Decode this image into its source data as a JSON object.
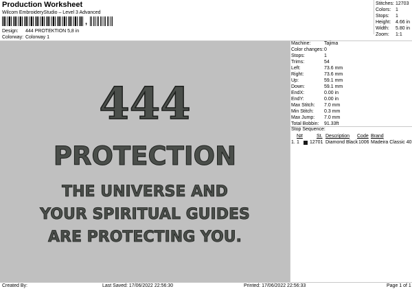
{
  "header": {
    "title": "Production Worksheet",
    "subtitle": "Wilcom EmbroideryStudio – Level 3 Advanced",
    "barcode_mark": ",",
    "design_label": "Design:",
    "design_value": "444 PROTEKTION 5,8 in",
    "colorway_label": "Colorway:",
    "colorway_value": "Colorway 1"
  },
  "stats": [
    {
      "label": "Stitches:",
      "value": "12703"
    },
    {
      "label": "Colors:",
      "value": "1"
    },
    {
      "label": "Stops:",
      "value": "1"
    },
    {
      "label": "Height:",
      "value": "4.66 in"
    },
    {
      "label": "Width:",
      "value": "5.80 in"
    },
    {
      "label": "Zoom:",
      "value": "1:1"
    }
  ],
  "design": {
    "line1": "444",
    "line2": "PROTECTION",
    "line3": "THE UNIVERSE AND",
    "line4": "YOUR SPIRITUAL GUIDES",
    "line5": "ARE PROTECTING YOU.",
    "thread_color": "#4a4e4a",
    "background_color": "#c0c0c0"
  },
  "machine_info": [
    {
      "label": "Machine:",
      "value": "Tajima"
    },
    {
      "label": "Color changes:",
      "value": "0"
    },
    {
      "label": "Stops:",
      "value": "1"
    },
    {
      "label": "Trims:",
      "value": "54"
    },
    {
      "label": "Left:",
      "value": "73.6 mm"
    },
    {
      "label": "Right:",
      "value": "73.6 mm"
    },
    {
      "label": "Up:",
      "value": "59.1 mm"
    },
    {
      "label": "Down:",
      "value": "59.1 mm"
    },
    {
      "label": "EndX:",
      "value": "0.00 in"
    },
    {
      "label": "EndY:",
      "value": "0.00 in"
    },
    {
      "label": "Max Stitch:",
      "value": "7.0 mm"
    },
    {
      "label": "Min Stitch:",
      "value": "0.3 mm"
    },
    {
      "label": "Max Jump:",
      "value": "7.0 mm"
    },
    {
      "label": "Total Bobbin:",
      "value": "91.33ft"
    }
  ],
  "stop_sequence": {
    "title": "Stop Sequence:",
    "headers": {
      "n": "N#",
      "st": "St.",
      "desc": "Description",
      "code": "Code",
      "brand": "Brand"
    },
    "rows": [
      {
        "idx": "1.",
        "n": "1",
        "color": "#1a1a1a",
        "st": "12701",
        "desc": "Diamond Black",
        "code": "1006",
        "brand": "Madeira Classic 40"
      }
    ]
  },
  "footer": {
    "created_by": "Created By:",
    "last_saved": "Last Saved: 17/06/2022 22:56:30",
    "printed": "Printed: 17/06/2022 22:56:33",
    "page": "Page 1 of 1"
  }
}
